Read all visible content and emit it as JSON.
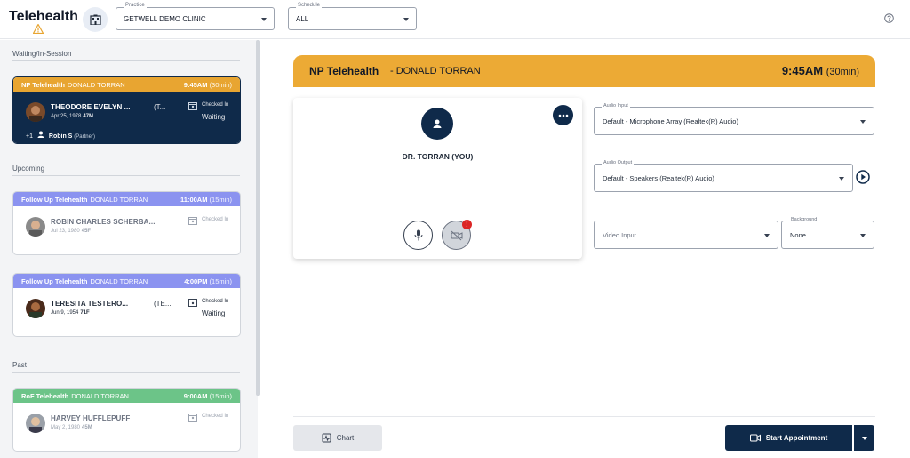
{
  "app": {
    "title": "Telehealth"
  },
  "colors": {
    "accent_navy": "#0f2a4a",
    "banner_orange": "#ecaa35",
    "card_purple": "#8b93f0",
    "card_green": "#6cc488",
    "card_orange": "#e8a531"
  },
  "header": {
    "practice": {
      "label": "Practice",
      "value": "GETWELL DEMO CLINIC"
    },
    "schedule": {
      "label": "Schedule",
      "value": "ALL"
    }
  },
  "sidebar": {
    "sections": {
      "waiting": "Waiting/In-Session",
      "upcoming": "Upcoming",
      "past": "Past"
    },
    "cards": [
      {
        "type": "NP Telehealth",
        "provider": "DONALD TORRAN",
        "time": "9:45AM",
        "duration": "(30min)",
        "patient": "THEODORE EVELYN ...",
        "tag": "(T...",
        "dob": "Apr 25, 1978",
        "age": "47M",
        "checkin": "Checked In",
        "status": "Waiting",
        "companion_count": "+1",
        "companion_name": "Robin S",
        "companion_rel": "(Partner)"
      },
      {
        "type": "Follow Up Telehealth",
        "provider": "DONALD TORRAN",
        "time": "11:00AM",
        "duration": "(15min)",
        "patient": "ROBIN CHARLES SCHERBA...",
        "dob": "Jul 23, 1980",
        "age": "45F",
        "checkin": "Checked In"
      },
      {
        "type": "Follow Up Telehealth",
        "provider": "DONALD TORRAN",
        "time": "4:00PM",
        "duration": "(15min)",
        "patient": "TERESITA TESTERO...",
        "tag": "(TE...",
        "dob": "Jun 9, 1954",
        "age": "71F",
        "checkin": "Checked In",
        "status": "Waiting"
      },
      {
        "type": "RoF Telehealth",
        "provider": "DONALD TORRAN",
        "time": "9:00AM",
        "duration": "(15min)",
        "patient": "HARVEY HUFFLEPUFF",
        "dob": "May 2, 1980",
        "age": "45M",
        "checkin": "Checked In"
      }
    ]
  },
  "main": {
    "banner": {
      "title": "NP Telehealth",
      "provider": "- DONALD TORRAN",
      "time": "9:45AM",
      "duration": "(30min)"
    },
    "video": {
      "self_name": "DR. TORRAN (YOU)",
      "alert": "!"
    },
    "audio_input": {
      "label": "Audio Input",
      "value": "Default - Microphone Array (Realtek(R) Audio)"
    },
    "audio_output": {
      "label": "Audio Output",
      "value": "Default - Speakers (Realtek(R) Audio)"
    },
    "video_input": {
      "placeholder": "Video Input"
    },
    "background": {
      "label": "Background",
      "value": "None"
    },
    "chart_button": "Chart",
    "start_button": "Start Appointment"
  }
}
